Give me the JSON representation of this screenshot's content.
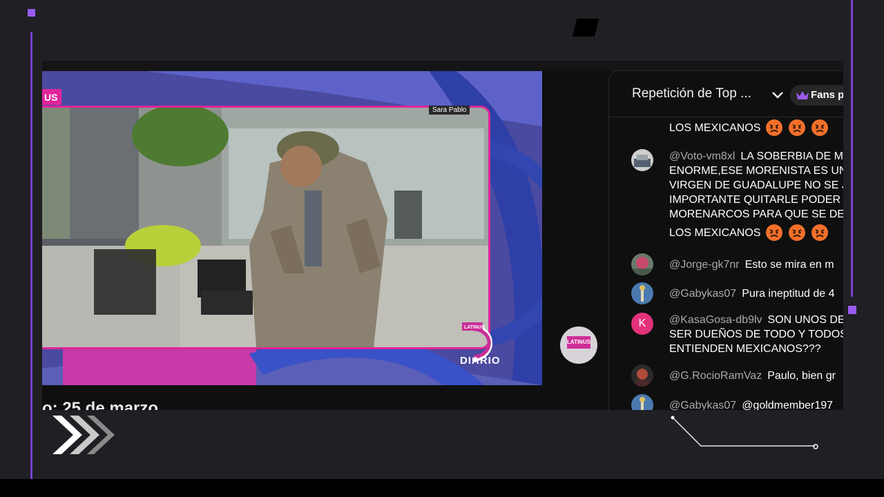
{
  "video": {
    "corner_tag": "US",
    "name_tag": "Sara Pablo",
    "logo_small": "LATINUS",
    "logo_text": "DIARIO",
    "side_logo": "LATINUS",
    "title_partial": "o: 25 de marzo"
  },
  "chat": {
    "title": "Repetición de Top ...",
    "dropdown_icon": "chevron-down-icon",
    "fans_label": "Fans p",
    "fans_icon": "crown-icon",
    "messages": [
      {
        "author": "",
        "lines": [
          "LOS MEXICANOS"
        ],
        "emojis": 3
      },
      {
        "author": "@Voto-vm8xl",
        "lines": [
          "LA SOBERBIA DE M",
          "ENORME,ESE MORENISTA ES UN",
          "VIRGEN DE GUADALUPE NO SE JU",
          "IMPORTANTE QUITARLE PODER A",
          "MORENARCOS PARA QUE SE DEJ",
          "LOS MEXICANOS"
        ],
        "emojis": 3
      },
      {
        "author": "@Jorge-gk7nr",
        "lines": [
          "Esto se mira en m"
        ]
      },
      {
        "author": "@Gabykas07",
        "lines": [
          "Pura ineptitud de 4"
        ]
      },
      {
        "author": "@KasaGosa-db9lv",
        "avatar_letter": "K",
        "lines": [
          "SON UNOS DE",
          "SER DUEÑOS DE TODO Y TODOS.",
          "ENTIENDEN MEXICANOS???"
        ]
      },
      {
        "author": "@G.RocioRamVaz",
        "lines": [
          "Paulo, bien gr"
        ]
      },
      {
        "author": "@Gabykas07",
        "lines": [
          "@goldmember197"
        ]
      }
    ]
  },
  "colors": {
    "accent_purple": "#7a3fd0",
    "brand_magenta": "#e0259a",
    "background": "#1f1f24"
  }
}
